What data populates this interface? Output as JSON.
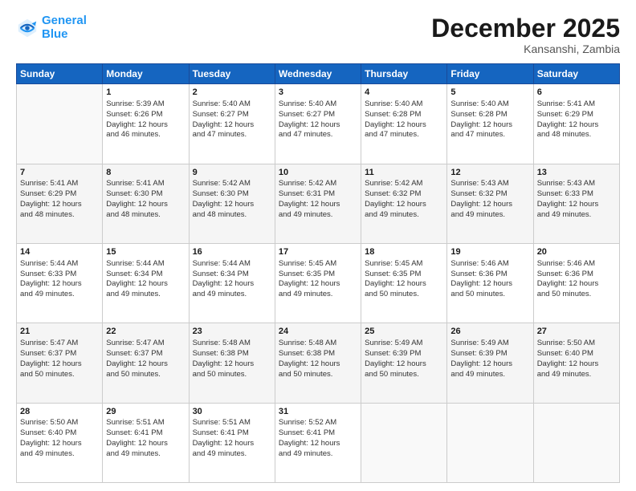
{
  "logo": {
    "line1": "General",
    "line2": "Blue"
  },
  "title": "December 2025",
  "subtitle": "Kansanshi, Zambia",
  "days_of_week": [
    "Sunday",
    "Monday",
    "Tuesday",
    "Wednesday",
    "Thursday",
    "Friday",
    "Saturday"
  ],
  "weeks": [
    [
      {
        "day": "",
        "info": ""
      },
      {
        "day": "1",
        "info": "Sunrise: 5:39 AM\nSunset: 6:26 PM\nDaylight: 12 hours\nand 46 minutes."
      },
      {
        "day": "2",
        "info": "Sunrise: 5:40 AM\nSunset: 6:27 PM\nDaylight: 12 hours\nand 47 minutes."
      },
      {
        "day": "3",
        "info": "Sunrise: 5:40 AM\nSunset: 6:27 PM\nDaylight: 12 hours\nand 47 minutes."
      },
      {
        "day": "4",
        "info": "Sunrise: 5:40 AM\nSunset: 6:28 PM\nDaylight: 12 hours\nand 47 minutes."
      },
      {
        "day": "5",
        "info": "Sunrise: 5:40 AM\nSunset: 6:28 PM\nDaylight: 12 hours\nand 47 minutes."
      },
      {
        "day": "6",
        "info": "Sunrise: 5:41 AM\nSunset: 6:29 PM\nDaylight: 12 hours\nand 48 minutes."
      }
    ],
    [
      {
        "day": "7",
        "info": "Sunrise: 5:41 AM\nSunset: 6:29 PM\nDaylight: 12 hours\nand 48 minutes."
      },
      {
        "day": "8",
        "info": "Sunrise: 5:41 AM\nSunset: 6:30 PM\nDaylight: 12 hours\nand 48 minutes."
      },
      {
        "day": "9",
        "info": "Sunrise: 5:42 AM\nSunset: 6:30 PM\nDaylight: 12 hours\nand 48 minutes."
      },
      {
        "day": "10",
        "info": "Sunrise: 5:42 AM\nSunset: 6:31 PM\nDaylight: 12 hours\nand 49 minutes."
      },
      {
        "day": "11",
        "info": "Sunrise: 5:42 AM\nSunset: 6:32 PM\nDaylight: 12 hours\nand 49 minutes."
      },
      {
        "day": "12",
        "info": "Sunrise: 5:43 AM\nSunset: 6:32 PM\nDaylight: 12 hours\nand 49 minutes."
      },
      {
        "day": "13",
        "info": "Sunrise: 5:43 AM\nSunset: 6:33 PM\nDaylight: 12 hours\nand 49 minutes."
      }
    ],
    [
      {
        "day": "14",
        "info": "Sunrise: 5:44 AM\nSunset: 6:33 PM\nDaylight: 12 hours\nand 49 minutes."
      },
      {
        "day": "15",
        "info": "Sunrise: 5:44 AM\nSunset: 6:34 PM\nDaylight: 12 hours\nand 49 minutes."
      },
      {
        "day": "16",
        "info": "Sunrise: 5:44 AM\nSunset: 6:34 PM\nDaylight: 12 hours\nand 49 minutes."
      },
      {
        "day": "17",
        "info": "Sunrise: 5:45 AM\nSunset: 6:35 PM\nDaylight: 12 hours\nand 49 minutes."
      },
      {
        "day": "18",
        "info": "Sunrise: 5:45 AM\nSunset: 6:35 PM\nDaylight: 12 hours\nand 50 minutes."
      },
      {
        "day": "19",
        "info": "Sunrise: 5:46 AM\nSunset: 6:36 PM\nDaylight: 12 hours\nand 50 minutes."
      },
      {
        "day": "20",
        "info": "Sunrise: 5:46 AM\nSunset: 6:36 PM\nDaylight: 12 hours\nand 50 minutes."
      }
    ],
    [
      {
        "day": "21",
        "info": "Sunrise: 5:47 AM\nSunset: 6:37 PM\nDaylight: 12 hours\nand 50 minutes."
      },
      {
        "day": "22",
        "info": "Sunrise: 5:47 AM\nSunset: 6:37 PM\nDaylight: 12 hours\nand 50 minutes."
      },
      {
        "day": "23",
        "info": "Sunrise: 5:48 AM\nSunset: 6:38 PM\nDaylight: 12 hours\nand 50 minutes."
      },
      {
        "day": "24",
        "info": "Sunrise: 5:48 AM\nSunset: 6:38 PM\nDaylight: 12 hours\nand 50 minutes."
      },
      {
        "day": "25",
        "info": "Sunrise: 5:49 AM\nSunset: 6:39 PM\nDaylight: 12 hours\nand 50 minutes."
      },
      {
        "day": "26",
        "info": "Sunrise: 5:49 AM\nSunset: 6:39 PM\nDaylight: 12 hours\nand 49 minutes."
      },
      {
        "day": "27",
        "info": "Sunrise: 5:50 AM\nSunset: 6:40 PM\nDaylight: 12 hours\nand 49 minutes."
      }
    ],
    [
      {
        "day": "28",
        "info": "Sunrise: 5:50 AM\nSunset: 6:40 PM\nDaylight: 12 hours\nand 49 minutes."
      },
      {
        "day": "29",
        "info": "Sunrise: 5:51 AM\nSunset: 6:41 PM\nDaylight: 12 hours\nand 49 minutes."
      },
      {
        "day": "30",
        "info": "Sunrise: 5:51 AM\nSunset: 6:41 PM\nDaylight: 12 hours\nand 49 minutes."
      },
      {
        "day": "31",
        "info": "Sunrise: 5:52 AM\nSunset: 6:41 PM\nDaylight: 12 hours\nand 49 minutes."
      },
      {
        "day": "",
        "info": ""
      },
      {
        "day": "",
        "info": ""
      },
      {
        "day": "",
        "info": ""
      }
    ]
  ]
}
